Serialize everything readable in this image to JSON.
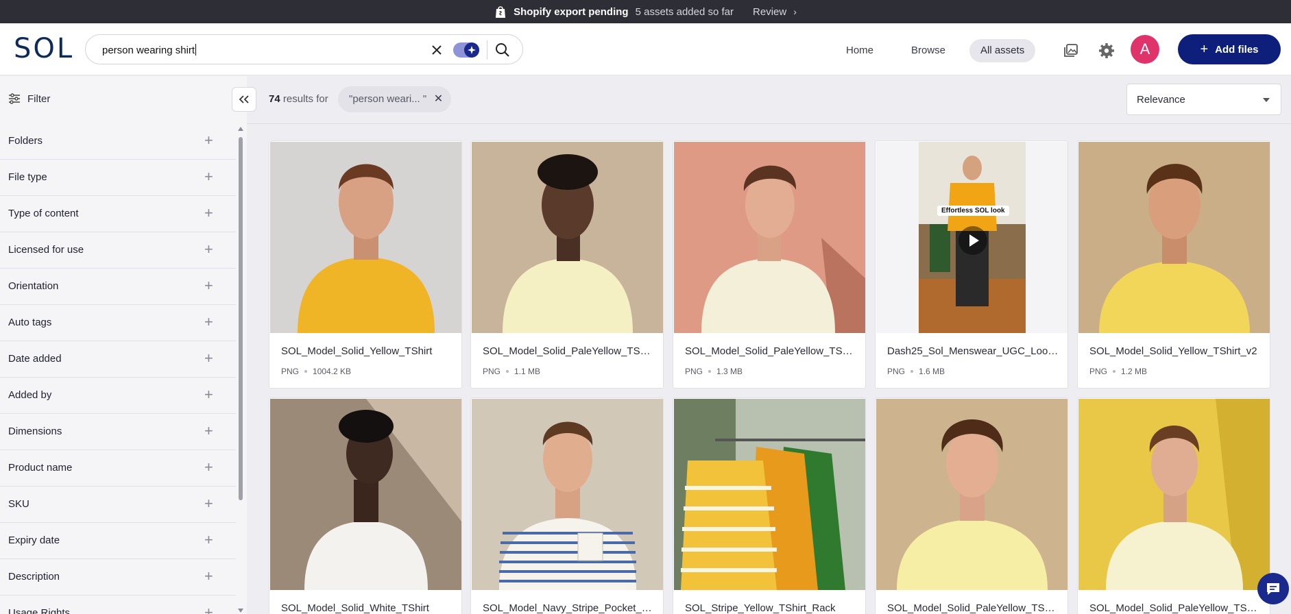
{
  "banner": {
    "title": "Shopify export pending",
    "subtitle": "5 assets added so far",
    "review_label": "Review"
  },
  "header": {
    "logo": "SOL",
    "search_value": "person wearing shirt",
    "nav": {
      "home": "Home",
      "browse": "Browse",
      "all_assets": "All assets"
    },
    "avatar_initial": "A",
    "add_files_label": "Add files"
  },
  "sidebar": {
    "filter_label": "Filter",
    "filters": [
      "Folders",
      "File type",
      "Type of content",
      "Licensed for use",
      "Orientation",
      "Auto tags",
      "Date added",
      "Added by",
      "Dimensions",
      "Product name",
      "SKU",
      "Expiry date",
      "Description",
      "Usage Rights"
    ]
  },
  "results": {
    "count": "74",
    "results_for": "results for",
    "query_chip": "\"person weari... \"",
    "sort_value": "Relevance"
  },
  "assets": [
    {
      "name": "SOL_Model_Solid_Yellow_TShirt",
      "type": "PNG",
      "size": "1004.2 KB"
    },
    {
      "name": "SOL_Model_Solid_PaleYellow_TShirt",
      "type": "PNG",
      "size": "1.1 MB"
    },
    {
      "name": "SOL_Model_Solid_PaleYellow_TShir...",
      "type": "PNG",
      "size": "1.3 MB"
    },
    {
      "name": "Dash25_Sol_Menswear_UGC_Look...",
      "type": "PNG",
      "size": "1.6 MB",
      "video_caption": "Effortless SOL look"
    },
    {
      "name": "SOL_Model_Solid_Yellow_TShirt_v2",
      "type": "PNG",
      "size": "1.2 MB"
    },
    {
      "name": "SOL_Model_Solid_White_TShirt"
    },
    {
      "name": "SOL_Model_Navy_Stripe_Pocket_T..."
    },
    {
      "name": "SOL_Stripe_Yellow_TShirt_Rack"
    },
    {
      "name": "SOL_Model_Solid_PaleYellow_TShir..."
    },
    {
      "name": "SOL_Model_Solid_PaleYellow_TShir..."
    }
  ],
  "colors": {
    "banner_bg": "#2d2e36",
    "brand_navy": "#0d1f7a",
    "avatar_pink": "#e0336c",
    "page_bg": "#eeeef2"
  }
}
